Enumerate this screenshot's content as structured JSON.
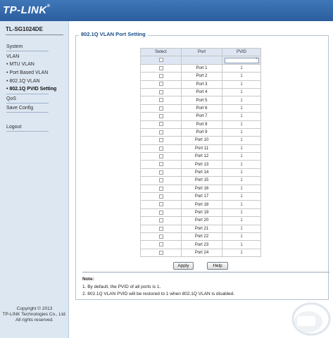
{
  "header": {
    "logo_text": "TP-LINK",
    "logo_mark": "®"
  },
  "sidebar": {
    "model": "TL-SG1024DE",
    "items": [
      {
        "label": "System"
      },
      {
        "label": "VLAN"
      },
      {
        "label": "• MTU VLAN"
      },
      {
        "label": "• Port Based VLAN"
      },
      {
        "label": "• 802.1Q VLAN"
      },
      {
        "label": "• 802.1Q PVID Setting"
      },
      {
        "label": "QoS"
      },
      {
        "label": "Save Config"
      },
      {
        "label": "Logout"
      }
    ],
    "copyright": [
      "Copyright © 2013",
      "TP-LINK Technologies Co., Ltd.",
      "All rights reserved."
    ]
  },
  "main": {
    "section_title": "802.1Q VLAN Port Setting",
    "table": {
      "headers": [
        "Select",
        "Port",
        "PVID"
      ],
      "edit_star": "*",
      "rows": [
        {
          "port": "Port 1",
          "pvid": "1"
        },
        {
          "port": "Port 2",
          "pvid": "1"
        },
        {
          "port": "Port 3",
          "pvid": "1"
        },
        {
          "port": "Port 4",
          "pvid": "1"
        },
        {
          "port": "Port 5",
          "pvid": "1"
        },
        {
          "port": "Port 6",
          "pvid": "1"
        },
        {
          "port": "Port 7",
          "pvid": "1"
        },
        {
          "port": "Port 8",
          "pvid": "1"
        },
        {
          "port": "Port 9",
          "pvid": "1"
        },
        {
          "port": "Port 10",
          "pvid": "1"
        },
        {
          "port": "Port 11",
          "pvid": "1"
        },
        {
          "port": "Port 12",
          "pvid": "1"
        },
        {
          "port": "Port 13",
          "pvid": "1"
        },
        {
          "port": "Port 14",
          "pvid": "1"
        },
        {
          "port": "Port 15",
          "pvid": "1"
        },
        {
          "port": "Port 16",
          "pvid": "1"
        },
        {
          "port": "Port 17",
          "pvid": "1"
        },
        {
          "port": "Port 18",
          "pvid": "1"
        },
        {
          "port": "Port 19",
          "pvid": "1"
        },
        {
          "port": "Port 20",
          "pvid": "1"
        },
        {
          "port": "Port 21",
          "pvid": "1"
        },
        {
          "port": "Port 22",
          "pvid": "1"
        },
        {
          "port": "Port 23",
          "pvid": "1"
        },
        {
          "port": "Port 24",
          "pvid": "1"
        }
      ]
    },
    "buttons": {
      "apply": "Apply",
      "help": "Help"
    },
    "note": {
      "title": "Note:",
      "lines": [
        "1. By default, the PVID of all ports is 1.",
        "2. 802.1Q VLAN PVID will be restored to 1 when 802.1Q VLAN is disabled."
      ]
    }
  },
  "colors": {
    "header": "#2c5e9f",
    "sidebar": "#dde7f2",
    "title": "#1a4f8a",
    "pvid": "#1a6a1a"
  }
}
